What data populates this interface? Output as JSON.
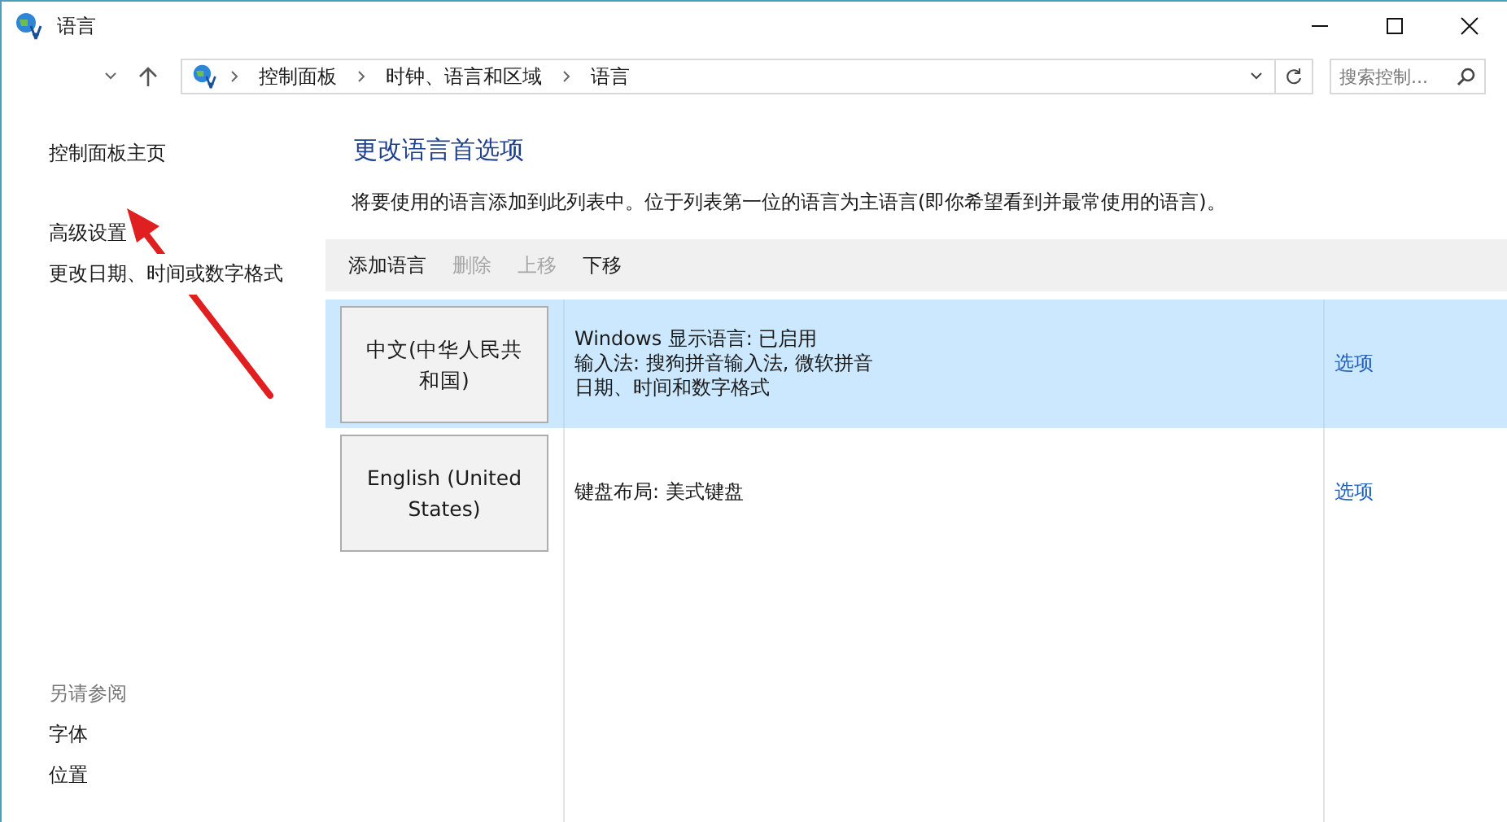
{
  "window": {
    "title": "语言"
  },
  "address_bar": {
    "path": [
      "控制面板",
      "时钟、语言和区域",
      "语言"
    ]
  },
  "search": {
    "placeholder": "搜索控制..."
  },
  "sidebar": {
    "items": [
      "控制面板主页",
      "高级设置",
      "更改日期、时间或数字格式"
    ],
    "see_also": {
      "heading": "另请参阅",
      "items": [
        "字体",
        "位置"
      ]
    }
  },
  "content": {
    "heading": "更改语言首选项",
    "description": "将要使用的语言添加到此列表中。位于列表第一位的语言为主语言(即你希望看到并最常使用的语言)。"
  },
  "toolbar": [
    {
      "label": "添加语言",
      "disabled": false
    },
    {
      "label": "删除",
      "disabled": true
    },
    {
      "label": "上移",
      "disabled": true
    },
    {
      "label": "下移",
      "disabled": false
    }
  ],
  "languages": [
    {
      "name": "中文(中华人民共和国)",
      "details": [
        "Windows 显示语言: 已启用",
        "输入法: 搜狗拼音输入法, 微软拼音",
        "日期、时间和数字格式"
      ],
      "options": "选项",
      "selected": true
    },
    {
      "name": "English (United States)",
      "details": [
        "键盘布局: 美式键盘"
      ],
      "options": "选项",
      "selected": false
    }
  ]
}
